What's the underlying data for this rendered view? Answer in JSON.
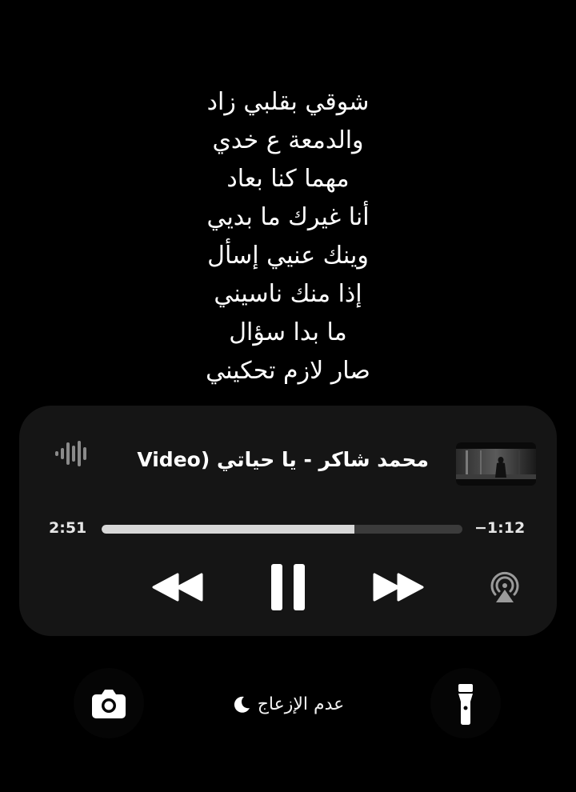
{
  "lyrics": {
    "lines": [
      "شوقي بقلبي زاد",
      "والدمعة ع خدي",
      "مهما كنا بعاد",
      "أنا غيرك ما بديي",
      "وينك عنيي إسأل",
      "إذا منك ناسيني",
      "ما بدا سؤال",
      "صار لازم تحكيني"
    ]
  },
  "player": {
    "title": "محمد شاكر - يا حياتي  (Video",
    "elapsed": "2:51",
    "remaining": "−1:12",
    "progress_fraction": 0.7,
    "icons": {
      "waveform": "waveform-icon",
      "rewind": "rewind-icon",
      "pause": "pause-icon",
      "forward": "fast-forward-icon",
      "airplay": "airplay-icon"
    }
  },
  "bottom": {
    "focus_label": "عدم الإزعاج",
    "icons": {
      "camera": "camera-icon",
      "moon": "moon-icon",
      "flashlight": "flashlight-icon"
    }
  },
  "colors": {
    "background": "#000000",
    "player_bg": "#151515",
    "progress_track": "#3b3b3b",
    "progress_fill": "#d8d8d8"
  }
}
